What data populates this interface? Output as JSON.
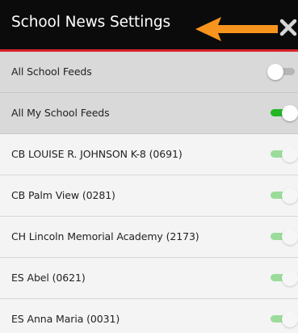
{
  "header": {
    "title": "School News Settings",
    "close_icon": "close-x-icon",
    "annotation_icon": "orange-arrow-left-icon",
    "colors": {
      "bar": "#0b0b0b",
      "accent_line": "#d9232d",
      "arrow": "#f7941d"
    }
  },
  "rows": [
    {
      "label": "All School Feeds",
      "toggle": "off",
      "enabled": true
    },
    {
      "label": "All My School Feeds",
      "toggle": "on",
      "enabled": true
    },
    {
      "label": "CB LOUISE R. JOHNSON K-8 (0691)",
      "toggle": "on",
      "enabled": false
    },
    {
      "label": "CB Palm View (0281)",
      "toggle": "on",
      "enabled": false
    },
    {
      "label": "CH Lincoln Memorial Academy (2173)",
      "toggle": "on",
      "enabled": false
    },
    {
      "label": "ES Abel (0621)",
      "toggle": "on",
      "enabled": false
    },
    {
      "label": "ES Anna Maria (0031)",
      "toggle": "on",
      "enabled": false
    }
  ],
  "colors": {
    "toggle_on": "#22b622",
    "toggle_on_disabled": "#9bdc9b",
    "toggle_off": "#b5b5b5"
  }
}
